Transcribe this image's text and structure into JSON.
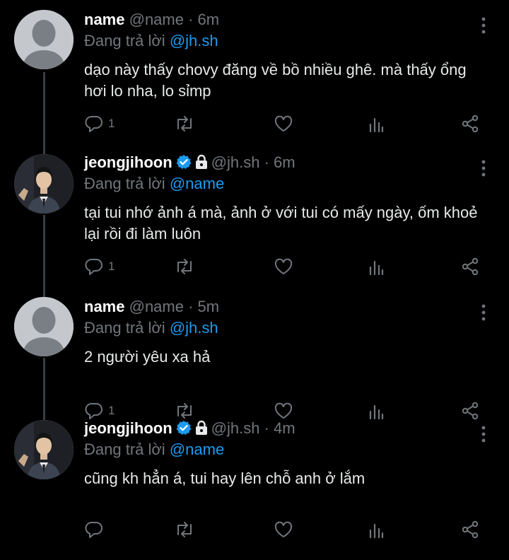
{
  "tweets": [
    {
      "name": "name",
      "handle": "@name",
      "time": "· 6m",
      "verified": false,
      "locked": false,
      "reply_prefix": "Đang trả lời",
      "reply_to": "@jh.sh",
      "text": "dạo này thấy chovy đăng về bồ nhiều ghê. mà thấy ổng hơi lo nha, lo sỉmp",
      "reply_count": "1",
      "avatar": "default-avatar"
    },
    {
      "name": "jeongjihoon",
      "handle": "@jh.sh",
      "time": "· 6m",
      "verified": true,
      "locked": true,
      "reply_prefix": "Đang trả lời",
      "reply_to": "@name",
      "text": "tại tui nhớ ảnh á mà, ảnh ở với tui có mấy ngày, ốm khoẻ lại rồi đi làm luôn",
      "reply_count": "1",
      "avatar": "photo-avatar"
    },
    {
      "name": "name",
      "handle": "@name",
      "time": "· 5m",
      "verified": false,
      "locked": false,
      "reply_prefix": "Đang trả lời",
      "reply_to": "@jh.sh",
      "text": "2 người yêu xa hả",
      "reply_count": "1",
      "avatar": "default-avatar"
    },
    {
      "name": "jeongjihoon",
      "handle": "@jh.sh",
      "time": "· 4m",
      "verified": true,
      "locked": true,
      "reply_prefix": "Đang trả lời",
      "reply_to": "@name",
      "text": "cũng kh hẳn á, tui hay lên chỗ anh ở lắm",
      "reply_count": "",
      "avatar": "photo-avatar"
    }
  ],
  "colors": {
    "background": "#000000",
    "text": "#e7e9ea",
    "muted": "#71767b",
    "accent": "#1d9bf0",
    "thread_line": "#3a3d42"
  },
  "icons": [
    "reply-icon",
    "retweet-icon",
    "like-icon",
    "views-icon",
    "share-icon",
    "more-icon",
    "verified-badge-icon",
    "lock-icon"
  ]
}
